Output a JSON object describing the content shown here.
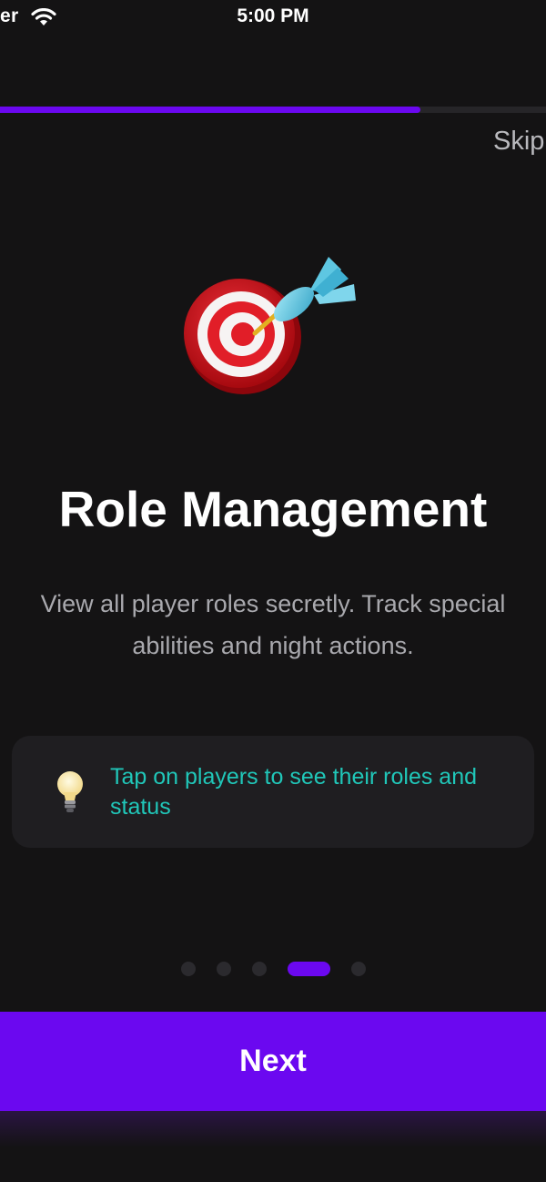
{
  "status_bar": {
    "carrier": "er",
    "time": "5:00 PM"
  },
  "progress": {
    "fraction": 0.77
  },
  "header": {
    "skip_label": "Skip"
  },
  "slide": {
    "icon": "dart-target-icon",
    "title": "Role Management",
    "description": "View all player roles secretly. Track special abilities and night actions.",
    "tip": {
      "icon": "light-bulb-icon",
      "text": "Tap on players to see their roles and status"
    }
  },
  "pagination": {
    "count": 5,
    "active_index": 3
  },
  "footer": {
    "next_label": "Next"
  },
  "colors": {
    "background": "#141314",
    "accent": "#6b08f0",
    "tip_text": "#20c7b9",
    "card": "#1f1e21"
  }
}
